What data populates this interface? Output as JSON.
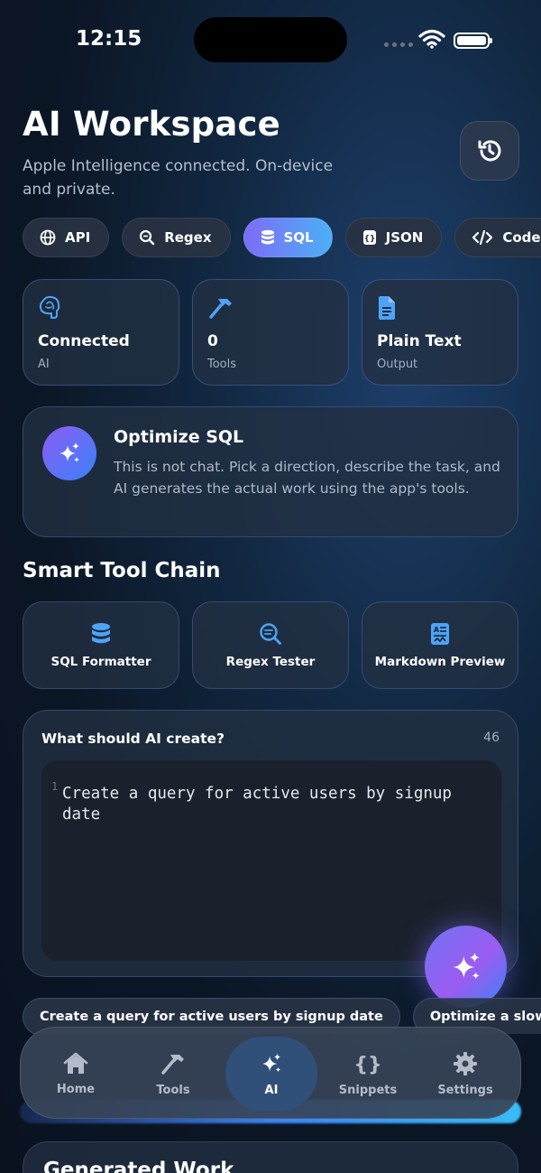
{
  "status_bar": {
    "time": "12:15"
  },
  "header": {
    "title": "AI Workspace",
    "subtitle": "Apple Intelligence connected. On-device and private.",
    "history_icon": "history-icon"
  },
  "chips": [
    {
      "label": "API",
      "icon": "globe-icon",
      "active": false
    },
    {
      "label": "Regex",
      "icon": "magnifier-icon",
      "active": false
    },
    {
      "label": "SQL",
      "icon": "database-icon",
      "active": true
    },
    {
      "label": "JSON",
      "icon": "json-icon",
      "active": false
    },
    {
      "label": "Code",
      "icon": "code-icon",
      "active": false
    }
  ],
  "stats": [
    {
      "value": "Connected",
      "label": "AI",
      "icon": "brain-icon"
    },
    {
      "value": "0",
      "label": "Tools",
      "icon": "hammer-icon"
    },
    {
      "value": "Plain Text",
      "label": "Output",
      "icon": "document-icon"
    }
  ],
  "banner": {
    "title": "Optimize SQL",
    "description": "This is not chat. Pick a direction, describe the task, and AI generates the actual work using the app's tools."
  },
  "tool_chain": {
    "title": "Smart Tool Chain",
    "tools": [
      {
        "label": "SQL Formatter",
        "icon": "database-icon"
      },
      {
        "label": "Regex Tester",
        "icon": "regex-search-icon"
      },
      {
        "label": "Markdown Preview",
        "icon": "markdown-icon"
      }
    ]
  },
  "prompt": {
    "title": "What should AI create?",
    "count": "46",
    "line_number": "1",
    "text": "Create a query for active users by signup date"
  },
  "suggestions": [
    "Create a query for active users by signup date",
    "Optimize a slow q"
  ],
  "tabs": [
    {
      "label": "Home",
      "icon": "house-icon",
      "active": false
    },
    {
      "label": "Tools",
      "icon": "hammer-icon",
      "active": false
    },
    {
      "label": "AI",
      "icon": "sparkles-icon",
      "active": true
    },
    {
      "label": "Snippets",
      "icon": "braces-icon",
      "active": false
    },
    {
      "label": "Settings",
      "icon": "gear-icon",
      "active": false
    }
  ],
  "generated": {
    "title": "Generated Work"
  },
  "colors": {
    "accent": "#4ea3f5",
    "violet": "#8b5cf6",
    "background": "#0f1d30"
  }
}
